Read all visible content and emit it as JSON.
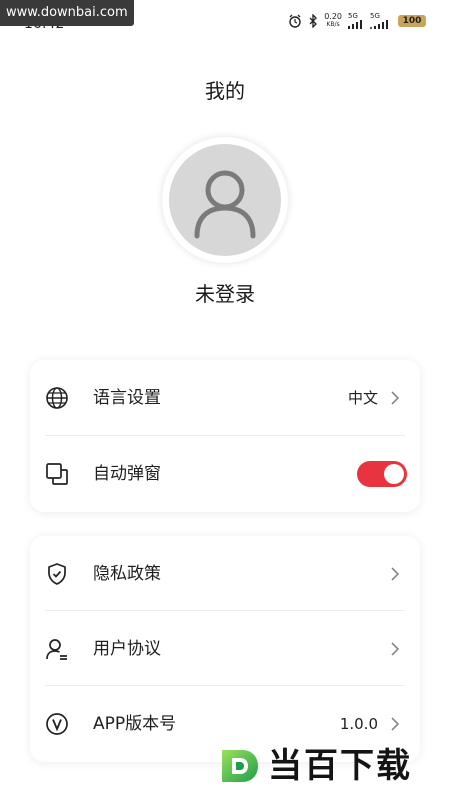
{
  "status_bar": {
    "watermark": "www.downbai.com",
    "time": "16:42",
    "net_speed": "0.20",
    "net_unit": "KB/s",
    "sim1": "5G",
    "sim2": "5G",
    "battery": "100"
  },
  "header": {
    "title": "我的",
    "login_status": "未登录"
  },
  "settings": {
    "language": {
      "label": "语言设置",
      "value": "中文",
      "icon": "globe-icon"
    },
    "auto_popup": {
      "label": "自动弹窗",
      "icon": "windows-icon",
      "enabled": true
    }
  },
  "info": {
    "privacy": {
      "label": "隐私政策",
      "icon": "shield-icon"
    },
    "agreement": {
      "label": "用户协议",
      "icon": "user-icon"
    },
    "version": {
      "label": "APP版本号",
      "value": "1.0.0",
      "icon": "version-icon"
    }
  },
  "brand_watermark": {
    "text": "当百下载"
  },
  "colors": {
    "accent": "#e8343f",
    "avatar_bg": "#d7d7d7",
    "divider": "#ececec"
  }
}
